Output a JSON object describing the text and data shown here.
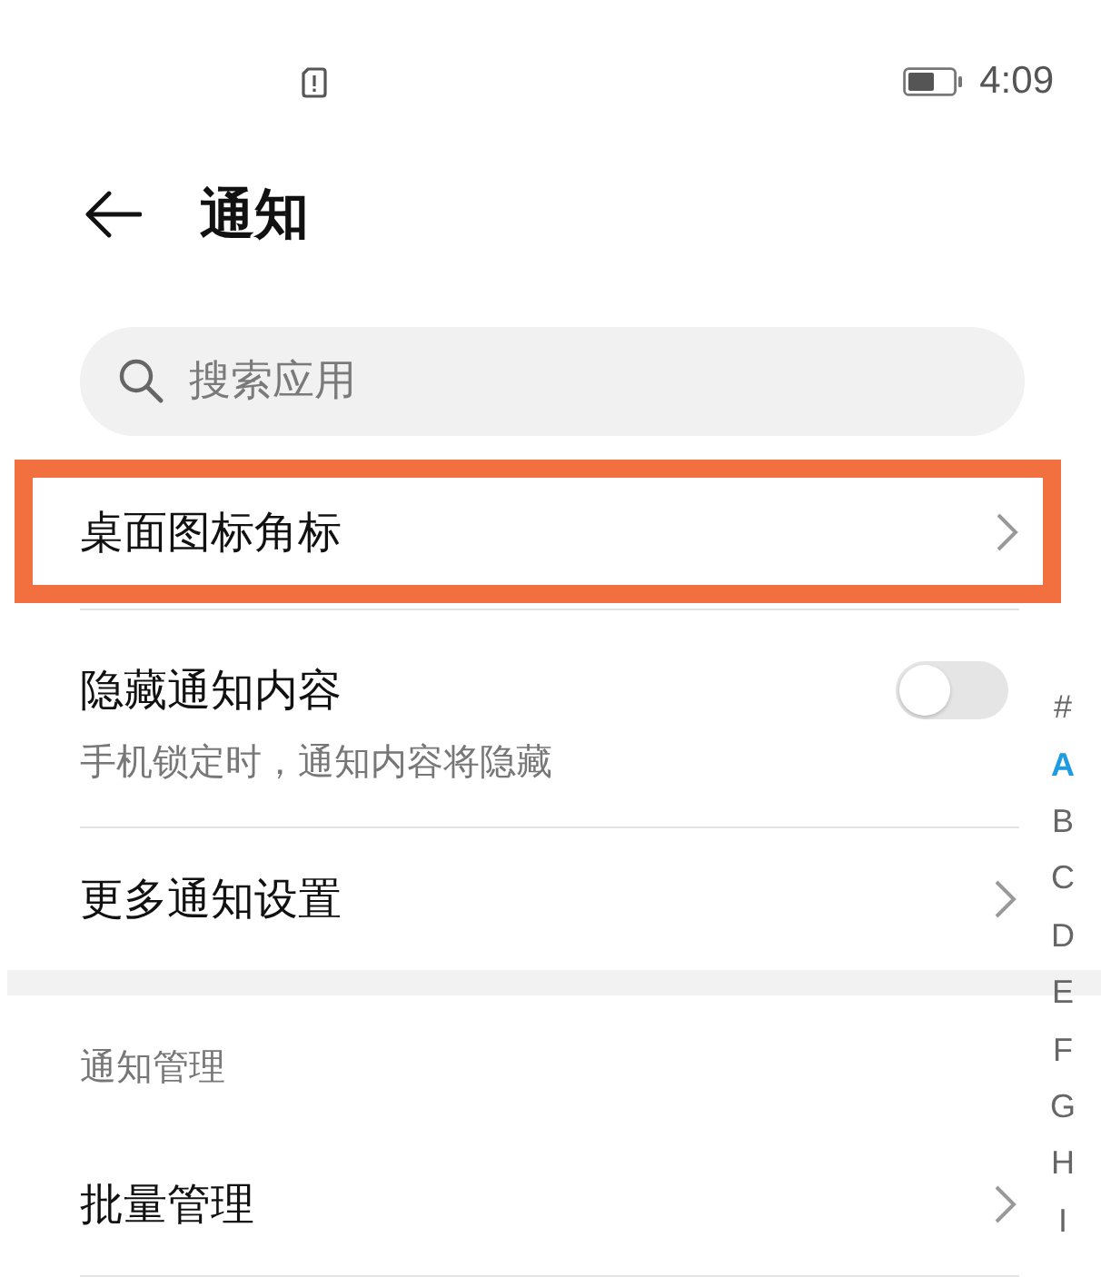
{
  "status_bar": {
    "time": "4:09"
  },
  "header": {
    "title": "通知"
  },
  "search": {
    "placeholder": "搜索应用"
  },
  "settings": [
    {
      "kind": "link",
      "label": "桌面图标角标",
      "highlighted": true
    },
    {
      "kind": "toggle",
      "label": "隐藏通知内容",
      "description": "手机锁定时，通知内容将隐藏",
      "on": false
    },
    {
      "kind": "link",
      "label": "更多通知设置",
      "highlighted": false
    }
  ],
  "section": {
    "title": "通知管理",
    "items": [
      {
        "kind": "link",
        "label": "批量管理",
        "highlighted": false
      }
    ]
  },
  "index_bar": [
    {
      "label": "#",
      "selected": false
    },
    {
      "label": "A",
      "selected": true
    },
    {
      "label": "B",
      "selected": false
    },
    {
      "label": "C",
      "selected": false
    },
    {
      "label": "D",
      "selected": false
    },
    {
      "label": "E",
      "selected": false
    },
    {
      "label": "F",
      "selected": false
    },
    {
      "label": "G",
      "selected": false
    },
    {
      "label": "H",
      "selected": false
    },
    {
      "label": "I",
      "selected": false
    }
  ]
}
